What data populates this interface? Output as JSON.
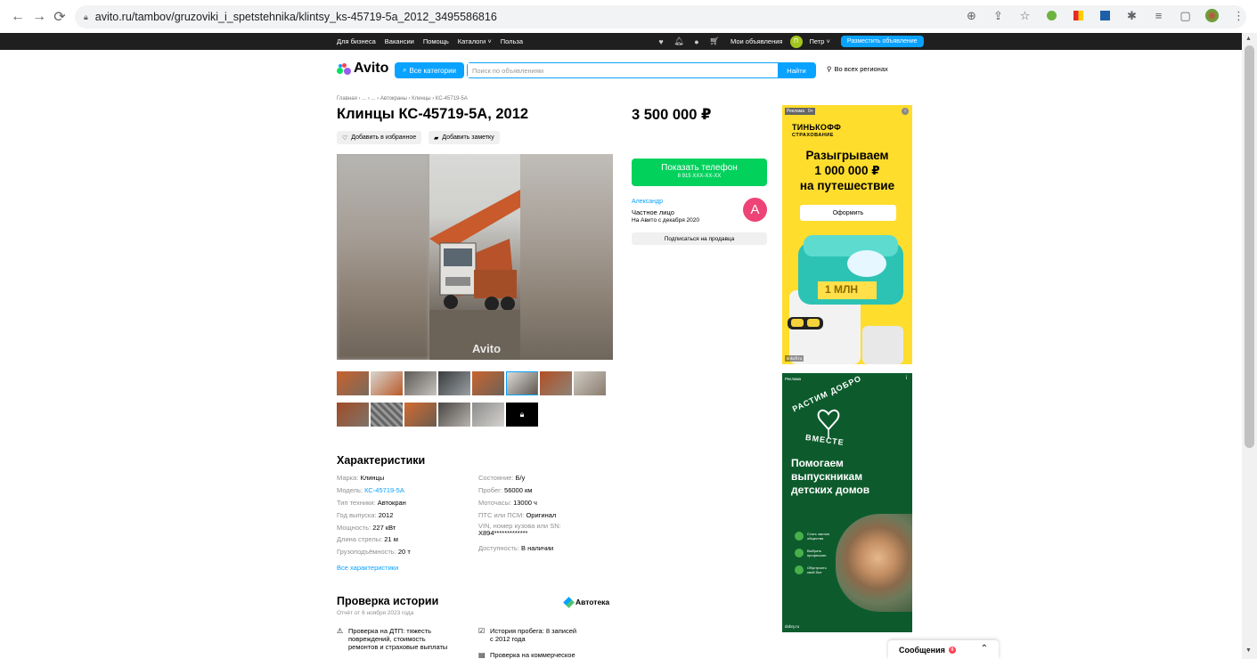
{
  "browser": {
    "url": "avito.ru/tambov/gruzoviki_i_spetstehnika/klintsy_ks-45719-5a_2012_3495586816"
  },
  "topbar": {
    "links": [
      "Для бизнеса",
      "Вакансии",
      "Помощь",
      "Каталоги",
      "Польза"
    ],
    "my_ads": "Мои объявления",
    "user": "Петр",
    "user_initial": "П",
    "post_button": "Разместить объявление"
  },
  "header": {
    "logo": "Avito",
    "categories_button": "Все категории",
    "search_placeholder": "Поиск по объявлениям",
    "search_button": "Найти",
    "region": "Во всех регионах"
  },
  "listing": {
    "breadcrumb": "Главная › ... › ... › Автокраны › Клинцы › КС-45719-5А",
    "title": "Клинцы КС-45719-5А, 2012",
    "price": "3 500 000 ₽",
    "favorite_button": "Добавить в избранное",
    "note_button": "Добавить заметку",
    "watermark": "Avito"
  },
  "seller": {
    "phone_button": "Показать телефон",
    "phone_masked": "8 915 XXX-XX-XX",
    "name": "Александр",
    "type": "Частное лицо",
    "since": "На Авито с декабря 2020",
    "initial": "А",
    "subscribe_button": "Подписаться на продавца"
  },
  "characteristics": {
    "heading": "Характеристики",
    "left": [
      {
        "k": "Марка:",
        "v": "Клинцы"
      },
      {
        "k": "Модель:",
        "v": "КС-45719-5А"
      },
      {
        "k": "Тип техники:",
        "v": "Автокран"
      },
      {
        "k": "Год выпуска:",
        "v": "2012"
      },
      {
        "k": "Мощность:",
        "v": "227 кВт"
      },
      {
        "k": "Длина стрелы:",
        "v": "21 м"
      },
      {
        "k": "Грузоподъёмность:",
        "v": "20 т"
      }
    ],
    "right": [
      {
        "k": "Состояние:",
        "v": "Б/у"
      },
      {
        "k": "Пробег:",
        "v": "56000 км"
      },
      {
        "k": "Моточасы:",
        "v": "13000 ч"
      },
      {
        "k": "ПТС или ПСМ:",
        "v": "Оригинал"
      },
      {
        "k": "VIN, номер кузова или SN:",
        "v": "X894*************"
      },
      {
        "k": "Доступность:",
        "v": "В наличии"
      }
    ],
    "all_link": "Все характеристики"
  },
  "history": {
    "heading": "Проверка истории",
    "date": "Отчёт от 6 ноября 2023 года",
    "brand": "Автотека",
    "item1_lines": [
      "Проверка на ДТП: тяжесть",
      "повреждений, стоимость",
      "ремонтов и страховые выплаты"
    ],
    "item2_lines": [
      "История пробега: 8 записей",
      "с 2012 года"
    ],
    "item3": "Проверка на коммерческое"
  },
  "ad1": {
    "tag": "Реклама",
    "age": "0+",
    "brand1": "ТИНЬКОФФ",
    "brand2": "СТРАХОВАНИЕ",
    "headline_lines": [
      "Разыгрываем",
      "1 000 000 ₽",
      "на путешествие"
    ],
    "cta": "Оформить",
    "art_text": "1 МЛН",
    "footer": "tinkoff.ru"
  },
  "ad2": {
    "tag": "Реклама",
    "arc_top": "РАСТИМ ДОБРО",
    "arc_bottom": "ВМЕСТЕ",
    "headline_lines": [
      "Помогаем",
      "выпускникам",
      "детских домов"
    ],
    "bullets": [
      [
        "Стать частью",
        "общества"
      ],
      [
        "Выбрать",
        "профессию"
      ],
      [
        "Обустроить",
        "свой быт"
      ]
    ],
    "footer": "dobry.ru"
  },
  "messages": {
    "label": "Сообщения",
    "count": "0"
  },
  "colors": {
    "accent": "#0aa2ff",
    "green": "#02d15c",
    "topbar": "#1f1f1f",
    "ad_yellow": "#ffdd2d",
    "ad_green": "#0d5b2d"
  }
}
